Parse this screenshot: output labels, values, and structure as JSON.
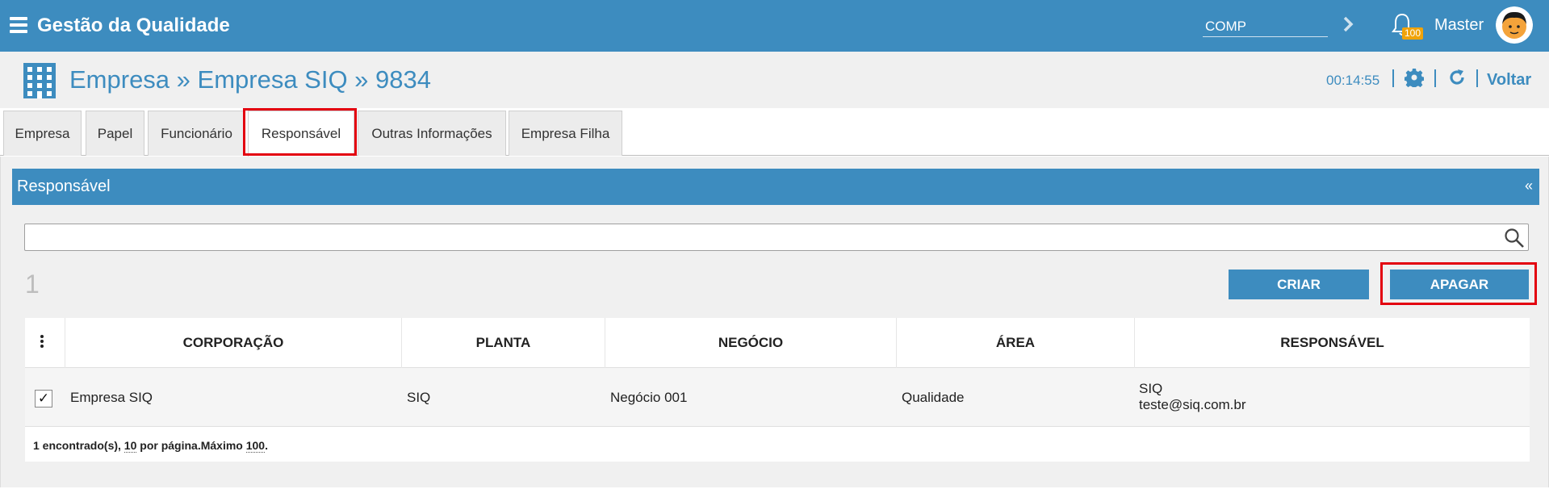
{
  "app": {
    "title": "Gestão da Qualidade"
  },
  "topbar": {
    "company_field": "COMP",
    "notification_count": "100",
    "user_name": "Master"
  },
  "header": {
    "title": "Empresa » Empresa SIQ » 9834",
    "timer": "00:14:55",
    "back_label": "Voltar"
  },
  "tabs": [
    {
      "label": "Empresa"
    },
    {
      "label": "Papel"
    },
    {
      "label": "Funcionário"
    },
    {
      "label": "Responsável"
    },
    {
      "label": "Outras Informações"
    },
    {
      "label": "Empresa Filha"
    }
  ],
  "panel": {
    "title": "Responsável",
    "collapse": "«",
    "count": "1",
    "create_label": "CRIAR",
    "delete_label": "APAGAR"
  },
  "table": {
    "columns": [
      "CORPORAÇÃO",
      "PLANTA",
      "NEGÓCIO",
      "ÁREA",
      "RESPONSÁVEL"
    ],
    "rows": [
      {
        "corporacao": "Empresa SIQ",
        "planta": "SIQ",
        "negocio": "Negócio 001",
        "area": "Qualidade",
        "responsavel_nome": "SIQ",
        "responsavel_email": "teste@siq.com.br",
        "checked": "✓"
      }
    ],
    "footer": {
      "prefix": "1 encontrado(s), ",
      "per_page": "10",
      "mid": " por página.Máximo ",
      "max": "100",
      "suffix": "."
    }
  },
  "colors": {
    "primary": "#3d8cbf",
    "highlight": "#e3000f",
    "badge": "#f0a30a"
  },
  "icons": [
    "menu-icon",
    "chevron-right-icon",
    "bell-icon",
    "building-icon",
    "gear-icon",
    "refresh-icon",
    "search-icon",
    "kebab-icon",
    "checkbox-icon"
  ]
}
